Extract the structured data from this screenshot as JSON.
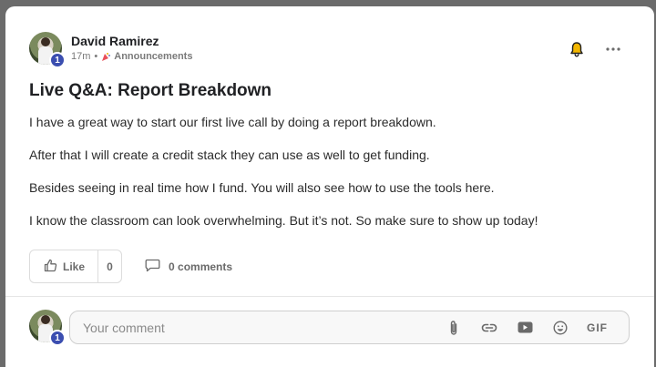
{
  "post": {
    "author": "David Ramirez",
    "level": "1",
    "time": "17m",
    "separator": "•",
    "category": "Announcements",
    "title": "Live Q&A: Report Breakdown",
    "paragraphs": [
      "I have a great way to start our first live call by doing a report breakdown.",
      "After that I will create a credit stack they can use as well to get funding.",
      "Besides seeing in real time how I fund. You will also see how to use the tools here.",
      "I know the classroom can look overwhelming. But it’s not. So make sure to show up today!"
    ]
  },
  "actions": {
    "like_label": "Like",
    "like_count": "0",
    "comments_label": "0 comments"
  },
  "composer": {
    "level": "1",
    "placeholder": "Your comment",
    "gif_label": "GIF"
  },
  "icons": {
    "bell": "bell-icon",
    "more": "more-icon",
    "like": "thumbs-up-icon",
    "comment": "comment-icon",
    "attach": "paperclip-icon",
    "link": "link-icon",
    "video": "video-icon",
    "emoji": "emoji-icon"
  },
  "colors": {
    "badge": "#3b4eb0",
    "bell": "#f2b600",
    "category_icon": "#e8505b"
  }
}
